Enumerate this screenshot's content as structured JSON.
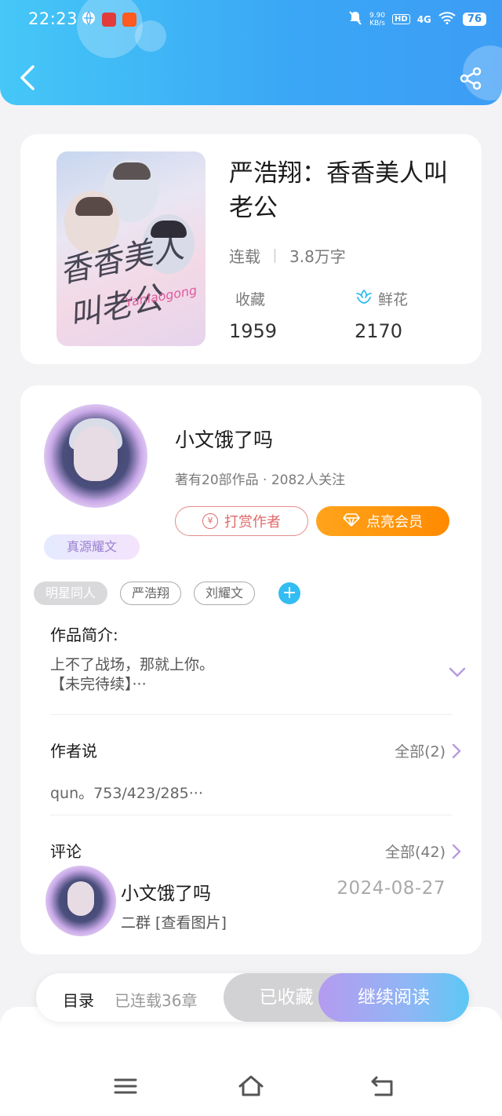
{
  "status_bar": {
    "time": "22:23",
    "net_speed": "9.90\nKB/s",
    "network": "4G",
    "battery": "76"
  },
  "book": {
    "title": "严浩翔：香香美人叫老公",
    "status": "连载",
    "word_count": "3.8万字",
    "collect_label": "收藏",
    "collect_count": "1959",
    "flower_label": "鲜花",
    "flower_count": "2170",
    "cover_text": "香香美人叫老公",
    "cover_sub": "Yanlaogong"
  },
  "author": {
    "name": "小文饿了吗",
    "stats": "著有20部作品 · 2082人关注",
    "badge": "真源耀文",
    "tip_label": "打赏作者",
    "vip_label": "点亮会员"
  },
  "tags": [
    "明星同人",
    "严浩翔",
    "刘耀文"
  ],
  "intro": {
    "title": "作品简介:",
    "line1": "上不了战场，那就上你。",
    "line2": "【未完待续】···"
  },
  "author_says": {
    "title": "作者说",
    "more": "全部(2)",
    "text": "qun。753/423/285···"
  },
  "comments": {
    "title": "评论",
    "more": "全部(42)",
    "items": [
      {
        "user": "小文饿了吗",
        "date": "2024-08-27",
        "text": "二群 [查看图片]"
      }
    ]
  },
  "bottom_bar": {
    "toc": "目录",
    "updates": "已连载36章",
    "collected": "已收藏",
    "continue": "继续阅读"
  },
  "colors": {
    "accent": "#3aa6f5",
    "vip": "#ff8a00",
    "tip": "#e06a6a"
  }
}
